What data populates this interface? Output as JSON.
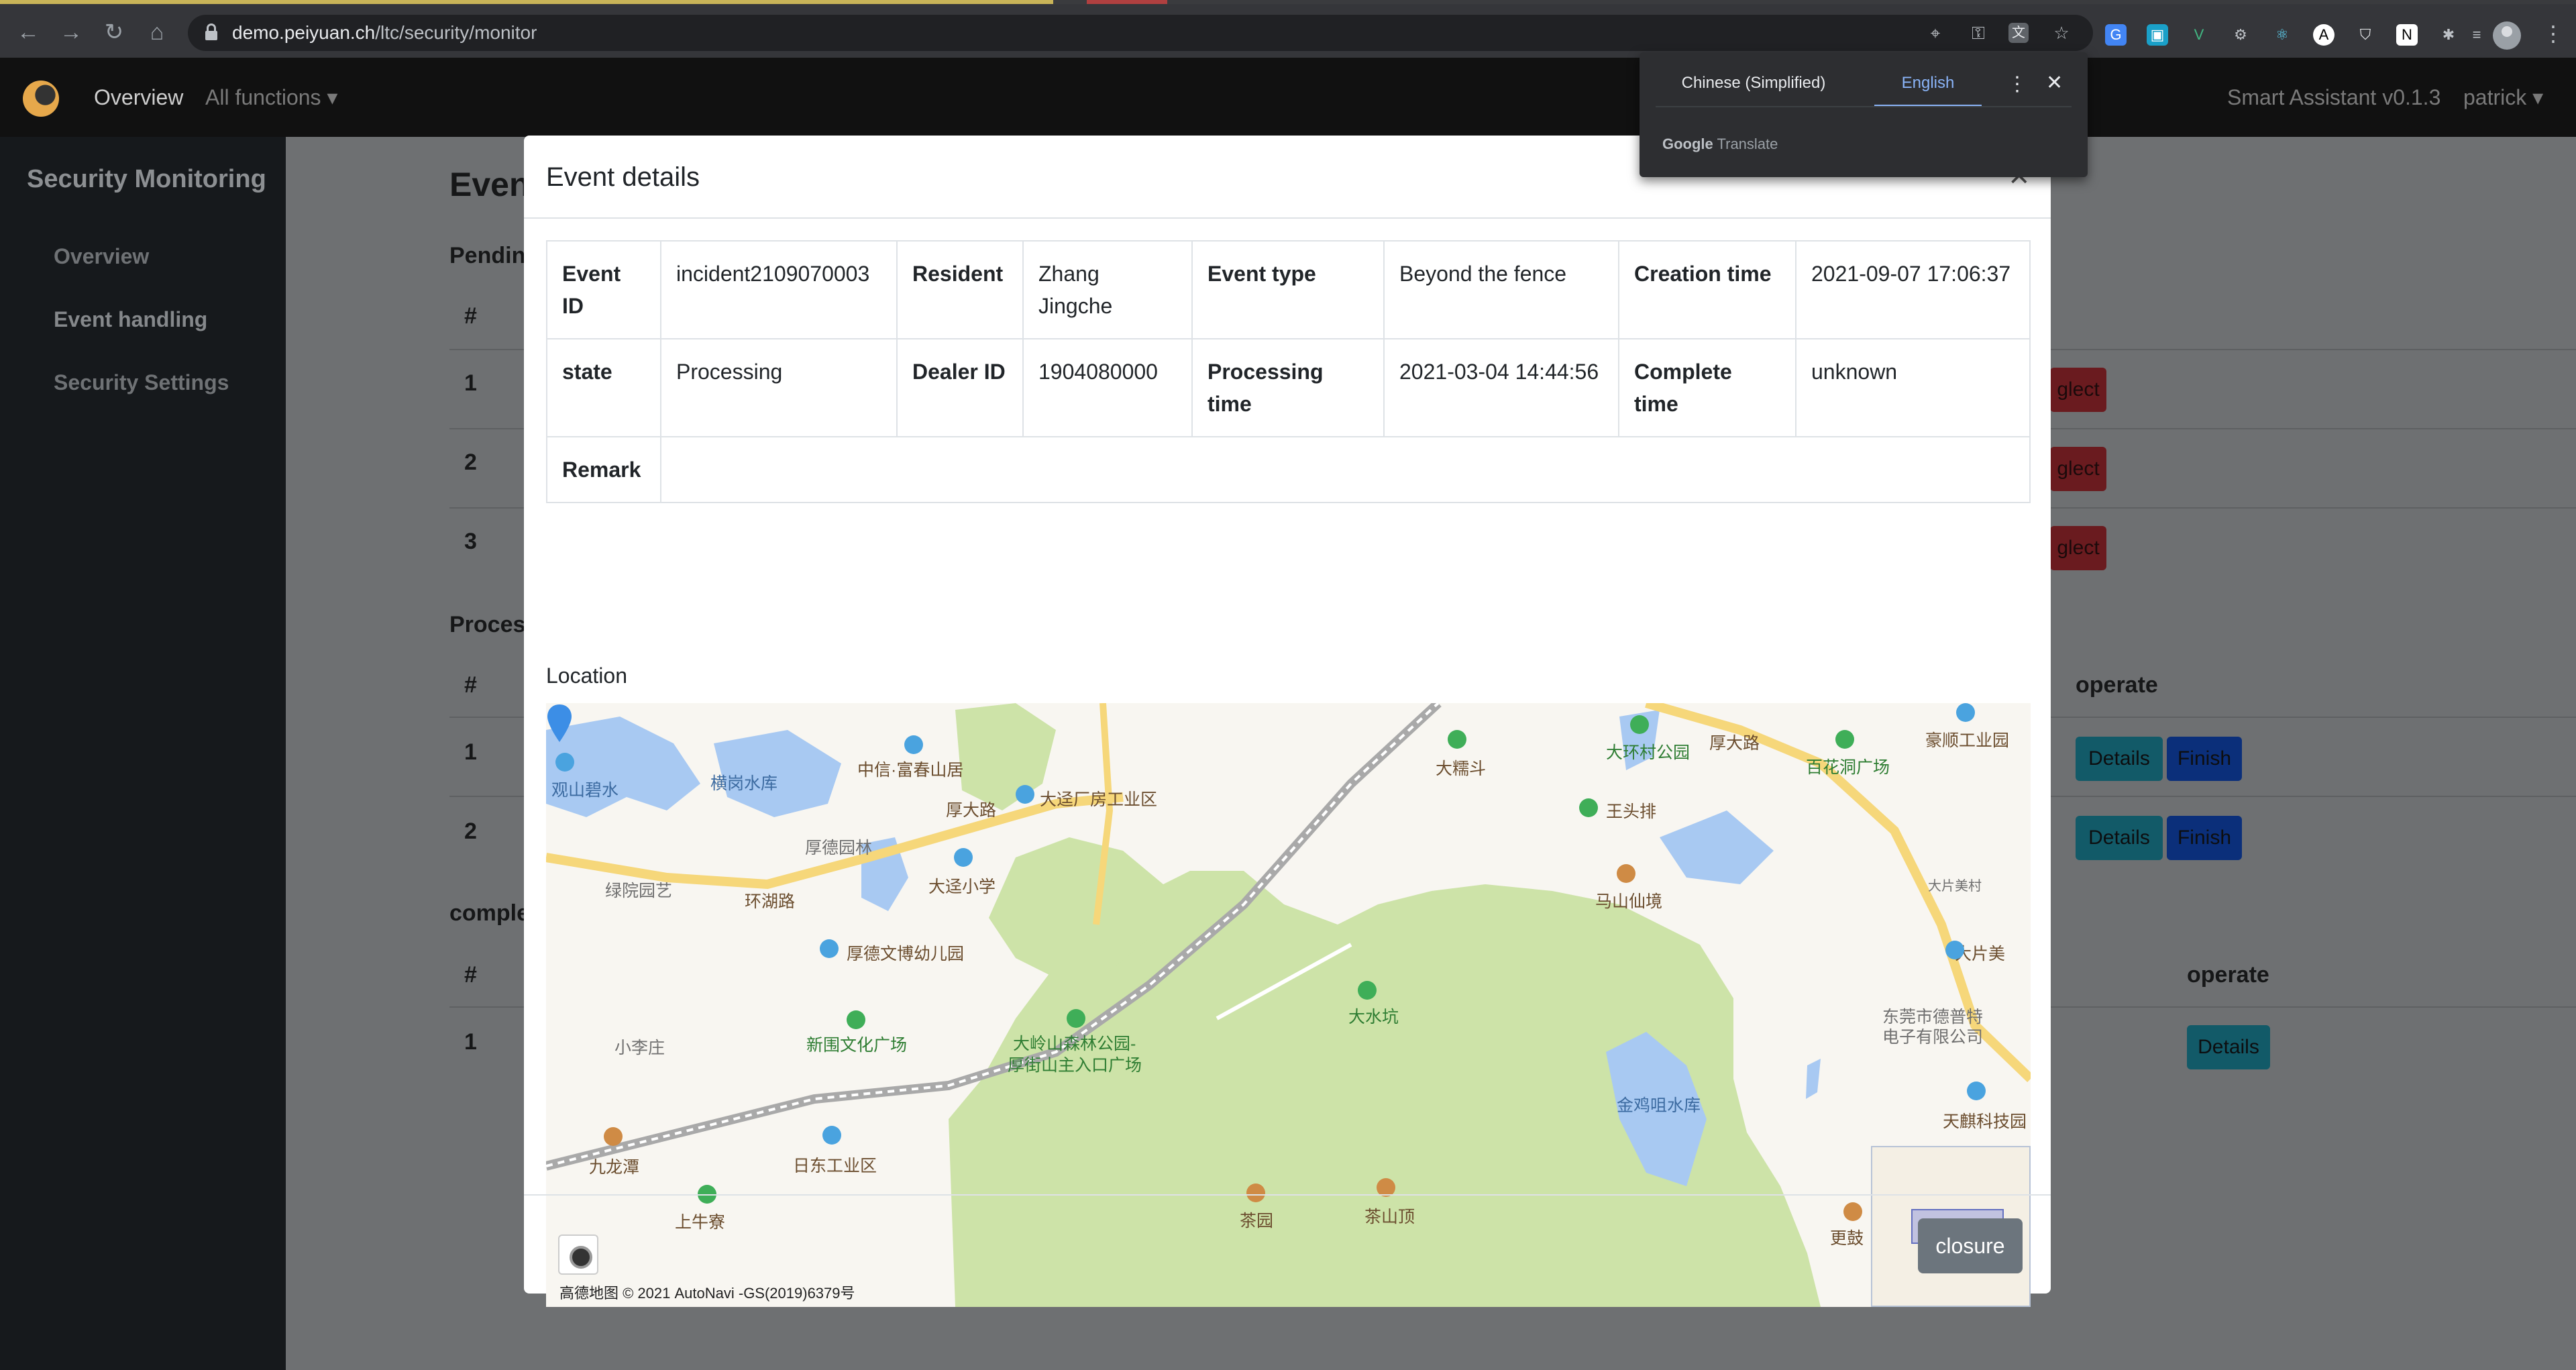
{
  "browser": {
    "url_host": "demo.peiyuan.ch",
    "url_path": "/ltc/security/monitor"
  },
  "app_nav": {
    "overview": "Overview",
    "all_functions": "All functions",
    "version": "Smart Assistant v0.1.3",
    "user": "patrick"
  },
  "sidebar": {
    "title": "Security Monitoring",
    "items": [
      {
        "label": "Overview"
      },
      {
        "label": "Event handling"
      },
      {
        "label": "Security Settings"
      }
    ]
  },
  "background": {
    "page_title": "Event",
    "section_pending": "Pending",
    "section_processing": "Process",
    "section_complete": "comple",
    "hash": "#",
    "operate": "operate",
    "neglect": "glect",
    "details": "Details",
    "finish": "Finish",
    "row1": "1",
    "row2": "2",
    "row3": "3"
  },
  "modal": {
    "title": "Event details",
    "close_symbol": "×",
    "fields": {
      "event_id_label": "Event ID",
      "event_id": "incident2109070003",
      "resident_label": "Resident",
      "resident": "Zhang Jingche",
      "event_type_label": "Event type",
      "event_type": "Beyond the fence",
      "creation_time_label": "Creation time",
      "creation_time": "2021-09-07 17:06:37",
      "state_label": "state",
      "state": "Processing",
      "dealer_id_label": "Dealer ID",
      "dealer_id": "1904080000",
      "processing_time_label": "Processing time",
      "processing_time": "2021-03-04 14:44:56",
      "complete_time_label": "Complete time",
      "complete_time": "unknown",
      "remark_label": "Remark",
      "remark": ""
    },
    "location_label": "Location",
    "map_copyright": "高德地图 © 2021 AutoNavi -GS(2019)6379号",
    "closure_button": "closure"
  },
  "map_labels": [
    "观山碧水",
    "横岗水库",
    "中信·富春山居",
    "大迳厂房工业区",
    "厚大路",
    "厚德园林",
    "大迳小学",
    "绿院园艺",
    "环湖路",
    "厚德文博幼儿园",
    "新围文化广场",
    "大岭山森林公园-",
    "厚街山主入口广场",
    "小李庄",
    "九龙潭",
    "日东工业区",
    "上牛寮",
    "茶园",
    "茶山顶",
    "大水坑",
    "大糯斗",
    "大环村公园",
    "厚大路",
    "百花洞广场",
    "豪顺工业园",
    "王头排",
    "马山仙境",
    "大片美",
    "大片美村",
    "东莞市德普特",
    "电子有限公司",
    "金鸡咀水库",
    "天麒科技园",
    "更鼓",
    "大岭"
  ],
  "translate_popup": {
    "lang_source": "Chinese (Simplified)",
    "lang_target": "English",
    "brand_google": "Google",
    "brand_translate": "Translate"
  }
}
